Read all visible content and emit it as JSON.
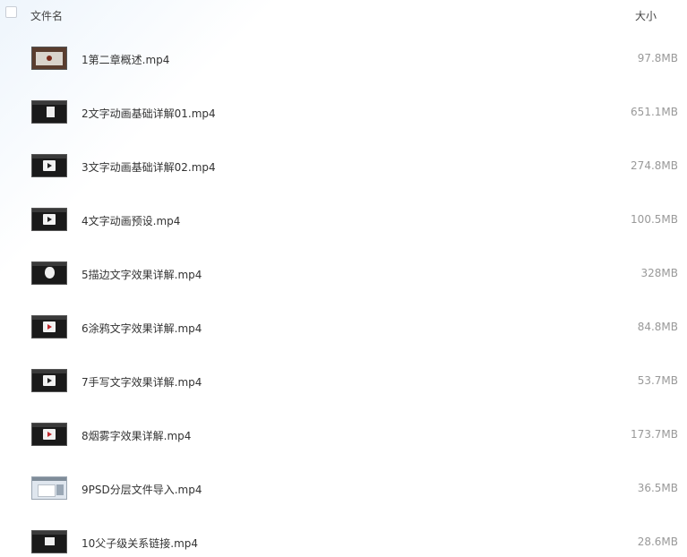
{
  "header": {
    "name_label": "文件名",
    "size_label": "大小"
  },
  "files": [
    {
      "name": "1第二章概述.mp4",
      "size": "97.8MB",
      "thumb": "video-thumbnail-intro"
    },
    {
      "name": "2文字动画基础详解01.mp4",
      "size": "651.1MB",
      "thumb": "video-thumbnail-paper"
    },
    {
      "name": "3文字动画基础详解02.mp4",
      "size": "274.8MB",
      "thumb": "video-thumbnail-play"
    },
    {
      "name": "4文字动画预设.mp4",
      "size": "100.5MB",
      "thumb": "video-thumbnail-play"
    },
    {
      "name": "5描边文字效果详解.mp4",
      "size": "328MB",
      "thumb": "video-thumbnail-apple"
    },
    {
      "name": "6涂鸦文字效果详解.mp4",
      "size": "84.8MB",
      "thumb": "video-thumbnail-play"
    },
    {
      "name": "7手写文字效果详解.mp4",
      "size": "53.7MB",
      "thumb": "video-thumbnail-play"
    },
    {
      "name": "8烟雾字效果详解.mp4",
      "size": "173.7MB",
      "thumb": "video-thumbnail-play"
    },
    {
      "name": "9PSD分层文件导入.mp4",
      "size": "36.5MB",
      "thumb": "video-thumbnail-document"
    },
    {
      "name": "10父子级关系链接.mp4",
      "size": "28.6MB",
      "thumb": "video-thumbnail-flag"
    }
  ]
}
